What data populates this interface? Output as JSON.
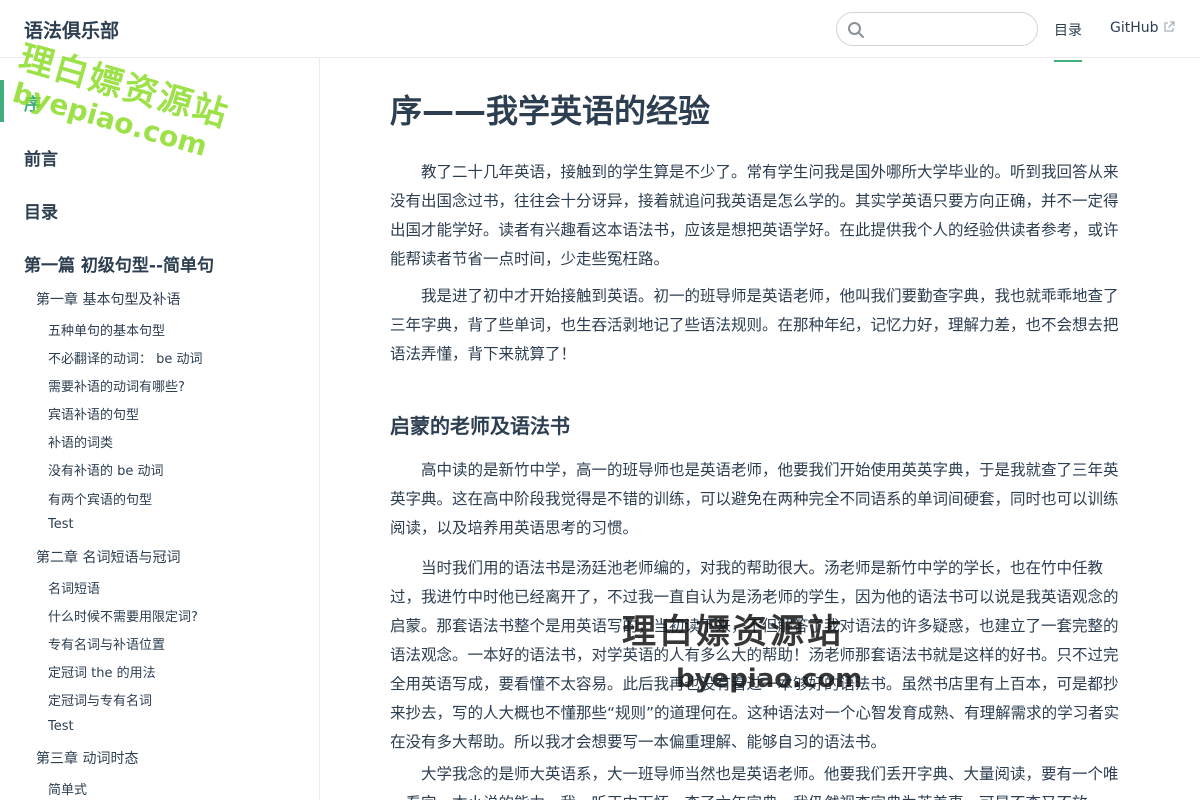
{
  "navbar": {
    "site_name": "语法俱乐部",
    "search": {
      "value": "",
      "placeholder": ""
    },
    "links": {
      "toc": "目录",
      "github": "GitHub"
    }
  },
  "sidebar": {
    "headings": {
      "preface": "序",
      "foreword": "前言",
      "contents": "目录",
      "part1": "第一篇 初级句型--简单句"
    },
    "ch1": {
      "title": "第一章 基本句型及补语",
      "items": [
        "五种单句的基本句型",
        "不必翻译的动词： be 动词",
        "需要补语的动词有哪些?",
        "宾语补语的句型",
        "补语的词类",
        "没有补语的 be 动词",
        "有两个宾语的句型",
        "Test"
      ]
    },
    "ch2": {
      "title": "第二章 名词短语与冠词",
      "items": [
        "名词短语",
        "什么时候不需要用限定词?",
        "专有名词与补语位置",
        "定冠词 the 的用法",
        "定冠词与专有名词",
        "Test"
      ]
    },
    "ch3": {
      "title": "第三章 动词时态",
      "items": [
        "简单式"
      ]
    }
  },
  "content": {
    "title": "序——我学英语的经验",
    "paragraphs": [
      "教了二十几年英语，接触到的学生算是不少了。常有学生问我是国外哪所大学毕业的。听到我回答从来没有出国念过书，往往会十分讶异，接着就追问我英语是怎么学的。其实学英语只要方向正确，并不一定得出国才能学好。读者有兴趣看这本语法书，应该是想把英语学好。在此提供我个人的经验供读者参考，或许能帮读者节省一点时间，少走些冤枉路。",
      "我是进了初中才开始接触到英语。初一的班导师是英语老师，他叫我们要勤查字典，我也就乖乖地查了三年字典，背了些单词，也生吞活剥地记了些语法规则。在那种年纪，记忆力好，理解力差，也不会想去把语法弄懂，背下来就算了！"
    ],
    "section1": {
      "title": "启蒙的老师及语法书",
      "paragraphs": [
        "高中读的是新竹中学，高一的班导师也是英语老师，他要我们开始使用英英字典，于是我就查了三年英英字典。这在高中阶段我觉得是不错的训练，可以避免在两种完全不同语系的单词间硬套，同时也可以训练阅读，以及培养用英语思考的习惯。",
        "当时我们用的语法书是汤廷池老师编的，对我的帮助很大。汤老师是新竹中学的学长，也在竹中任教过，我进竹中时他已经离开了，不过我一直自认为是汤老师的学生，因为他的语法书可以说是我英语观念的启蒙。那套语法书整个是用英语写的，当初读下来，不但解答了我对语法的许多疑惑，也建立了一套完整的语法观念。一本好的语法书，对学英语的人有多么大的帮助！汤老师那套语法书就是这样的好书。只不过完全用英语写成，要看懂不太容易。此后我再也没有看过一本够好的语法书。虽然书店里有上百本，可是都抄来抄去，写的人大概也不懂那些“规则”的道理何在。这种语法对一个心智发育成熟、有理解需求的学习者实在没有多大帮助。所以我才会想要写一本偏重理解、能够自习的语法书。",
        "大学我念的是师大英语系，大一班导师当然也是英语老师。他要我们丢开字典、大量阅读，要有一个唯一看完一本小说的能力，我一听正中下怀，查了六年字典，我仍然视查字典为苦差事，可是不查又不放"
      ]
    }
  },
  "watermarks": {
    "top_zh": "理白嫖资源站",
    "top_en": "byepiao.com",
    "mid_zh": "理白嫖资源站",
    "mid_en": "byepiao.com"
  }
}
